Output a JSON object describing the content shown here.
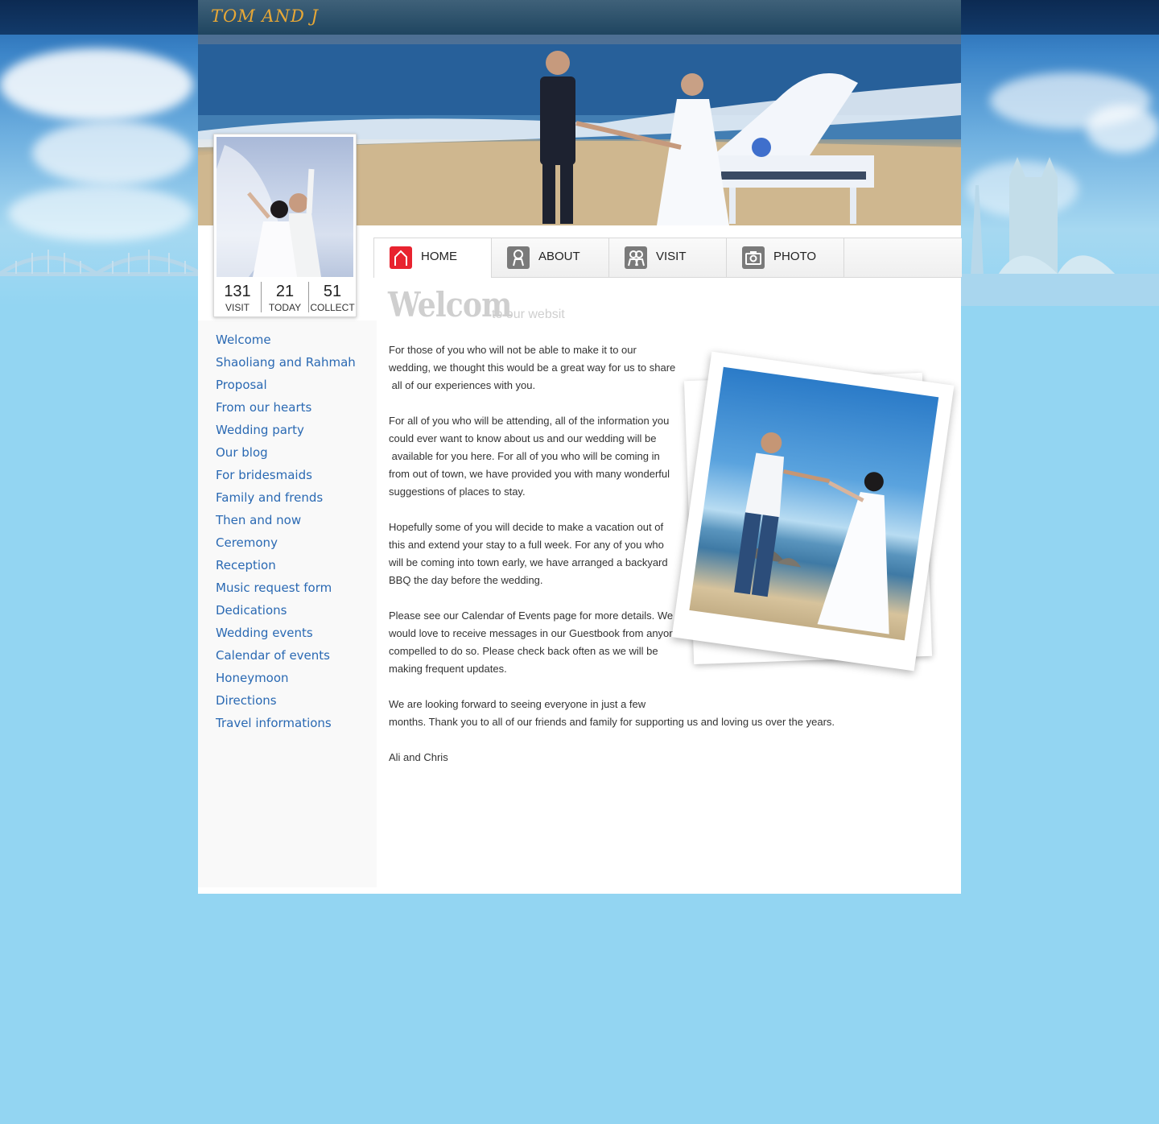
{
  "site": {
    "title": "TOM AND J"
  },
  "stats": [
    {
      "value": "131",
      "label": "VISIT"
    },
    {
      "value": "21",
      "label": "TODAY"
    },
    {
      "value": "51",
      "label": "COLLECT"
    }
  ],
  "nav_tabs": [
    {
      "label": "HOME",
      "icon": "home-icon",
      "active": true
    },
    {
      "label": "ABOUT",
      "icon": "person-icon",
      "active": false
    },
    {
      "label": "VISIT",
      "icon": "people-icon",
      "active": false
    },
    {
      "label": "PHOTO",
      "icon": "camera-icon",
      "active": false
    }
  ],
  "sidebar": {
    "links": [
      "Welcome",
      "Shaoliang and Rahmah",
      "Proposal",
      "From our hearts",
      "Wedding party",
      "Our blog",
      "For bridesmaids",
      "Family and frends",
      "Then and now",
      "Ceremony",
      "Reception",
      "Music request form",
      "Dedications",
      "Wedding events",
      "Calendar of events",
      "Honeymoon",
      "Directions",
      "Travel informations"
    ]
  },
  "content": {
    "title": "Welcom",
    "subtitle": "to our websit",
    "p1": [
      "For those of you who will not be able to make it to our",
      "wedding, we thought this would be a great way for us to share",
      "all of our experiences with you."
    ],
    "p2": [
      "For all of you who will be attending, all of the information you",
      "could ever want to know about us and our wedding will be",
      "available for you here. For all of you who will be coming in",
      "from out of town, we have provided you with many wonderful",
      "suggestions of places to stay."
    ],
    "p3": [
      "Hopefully some of you will decide to make a vacation out of",
      "this and extend your stay to a full week. For any of you who",
      "will be coming into town early, we have arranged a backyard",
      "BBQ the day before the wedding."
    ],
    "p4": [
      "Please see our Calendar of Events page for more details. We",
      "would love to receive messages in our Guestbook from anyone",
      "compelled to do so. Please check back often as we will be",
      "making frequent updates."
    ],
    "p5": [
      "We are looking forward to seeing everyone in just a few",
      "months. Thank you to all of our friends and family for supporting us and loving us over the years."
    ],
    "signature": "Ali and Chris"
  },
  "colors": {
    "brand_title": "#e8a836",
    "link": "#2a69b3",
    "active_tab_icon": "#e8232f",
    "page_bg": "#93d5f2"
  }
}
